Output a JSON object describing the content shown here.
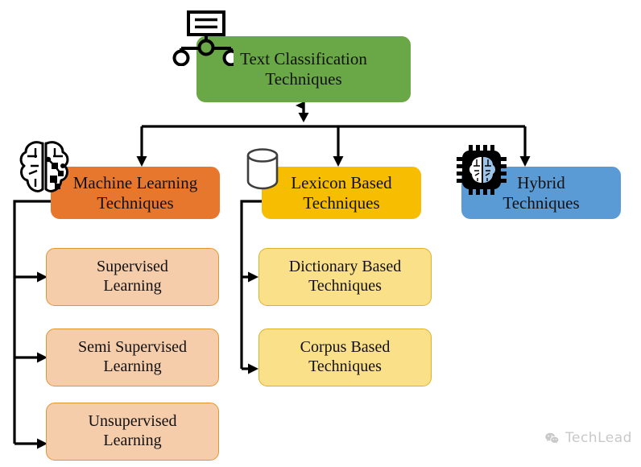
{
  "diagram": {
    "title_text": "Text Classification Techniques",
    "root": {
      "label": "Text Classification\nTechniques",
      "color": "#6aa747",
      "icon": "hierarchy-icon"
    },
    "branches": [
      {
        "id": "machine-learning",
        "label": "Machine Learning\nTechniques",
        "color": "#e8772e",
        "icon": "brain-icon",
        "children": [
          {
            "id": "supervised-learning",
            "label": "Supervised\nLearning",
            "color": "#f6cdab",
            "border": "#e3952f"
          },
          {
            "id": "semi-supervised-learning",
            "label": "Semi Supervised\nLearning",
            "color": "#f6cdab",
            "border": "#e3952f"
          },
          {
            "id": "unsupervised-learning",
            "label": "Unsupervised\nLearning",
            "color": "#f6cdab",
            "border": "#e3952f"
          }
        ]
      },
      {
        "id": "lexicon-based",
        "label": "Lexicon Based\nTechniques",
        "color": "#f7bd00",
        "icon": "database-icon",
        "children": [
          {
            "id": "dictionary-based",
            "label": "Dictionary Based\nTechniques",
            "color": "#fae089",
            "border": "#e0b02a"
          },
          {
            "id": "corpus-based",
            "label": "Corpus Based\nTechniques",
            "color": "#fae089",
            "border": "#e0b02a"
          }
        ]
      },
      {
        "id": "hybrid",
        "label": "Hybrid\nTechniques",
        "color": "#5b9bd5",
        "icon": "ai-chip-icon",
        "children": []
      }
    ]
  },
  "watermark": {
    "label": "TechLead",
    "icon": "wechat-icon",
    "color": "#c9c9c9"
  }
}
